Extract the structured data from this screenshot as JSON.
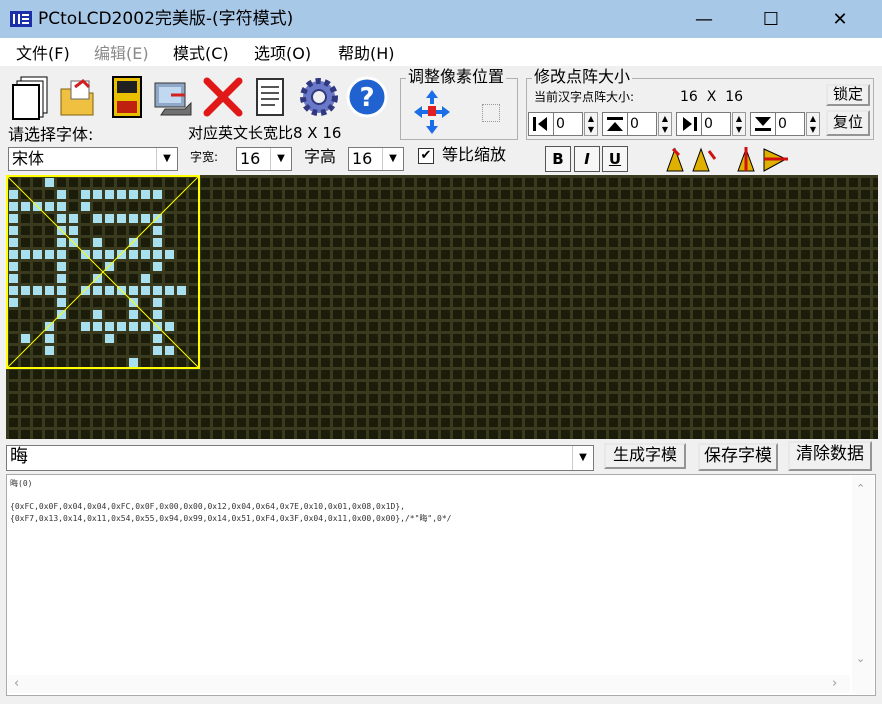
{
  "window": {
    "title": "PCtoLCD2002完美版-(字符模式)",
    "minimize_glyph": "—",
    "maximize_glyph": "☐",
    "close_glyph": "✕"
  },
  "menu": [
    "文件(F)",
    "编辑(E)",
    "模式(C)",
    "选项(O)",
    "帮助(H)"
  ],
  "toolbar_icons": [
    "new-file-icon",
    "open-folder-icon",
    "save-disk-icon",
    "generate-icon",
    "delete-icon",
    "notes-icon",
    "settings-gear-icon",
    "help-icon"
  ],
  "font_panel": {
    "select_label": "请选择字体:",
    "font_value": "宋体",
    "ratio_label": "对应英文长宽比8 X 16",
    "width_label": "字宽:",
    "width_value": "16",
    "height_label": "字高",
    "height_value": "16",
    "scale_label": "等比缩放",
    "scale_checked": true
  },
  "adjust_panel": {
    "title": "调整像素位置"
  },
  "resize_panel": {
    "title": "修改点阵大小",
    "current_label": "当前汉字点阵大小:",
    "current_value": "16  X  16",
    "lock_button": "锁定",
    "reset_button": "复位",
    "spin_values": [
      "0",
      "0",
      "0",
      "0"
    ]
  },
  "style_buttons": [
    "B",
    "I",
    "U"
  ],
  "input": {
    "value": "晦"
  },
  "buttons": {
    "generate": "生成字模",
    "save": "保存字模",
    "clear": "清除数据"
  },
  "output": {
    "lines": [
      "晦(0)",
      "{0xFC,0x0F,0x04,0x04,0xFC,0x0F,0x00,0x00,0x12,0x04,0x64,0x7E,0x10,0x01,0x08,0x1D},",
      "{0xF7,0x13,0x14,0x11,0x54,0x55,0x94,0x99,0x14,0x51,0xF4,0x3F,0x04,0x11,0x00,0x00},/*\"晦\",0*/"
    ]
  },
  "colors": {
    "grid_bg": "#3a3a1e",
    "cell_off": "#1c1c0a",
    "cell_on": "#a8e0f0",
    "frame": "#ffff00",
    "titlebar": "#a8c8e8"
  }
}
